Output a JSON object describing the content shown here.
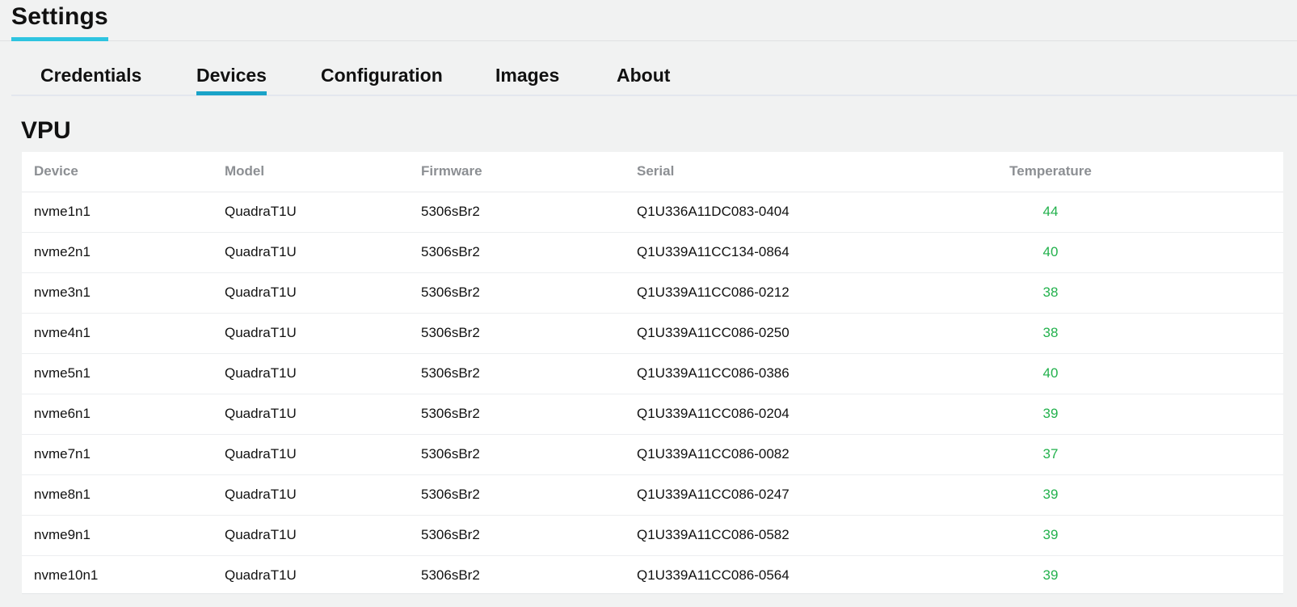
{
  "header": {
    "title": "Settings"
  },
  "tabs": [
    {
      "label": "Credentials",
      "active": false
    },
    {
      "label": "Devices",
      "active": true
    },
    {
      "label": "Configuration",
      "active": false
    },
    {
      "label": "Images",
      "active": false
    },
    {
      "label": "About",
      "active": false
    }
  ],
  "section": {
    "title": "VPU"
  },
  "colors": {
    "title_underline": "#2ec4e0",
    "active_tab_underline": "#1aa3c8",
    "temperature_ok": "#22b14c",
    "header_text": "#8c8f93"
  },
  "table": {
    "columns": [
      "Device",
      "Model",
      "Firmware",
      "Serial",
      "Temperature"
    ],
    "rows": [
      [
        "nvme1n1",
        "QuadraT1U",
        "5306sBr2",
        "Q1U336A11DC083-0404",
        "44"
      ],
      [
        "nvme2n1",
        "QuadraT1U",
        "5306sBr2",
        "Q1U339A11CC134-0864",
        "40"
      ],
      [
        "nvme3n1",
        "QuadraT1U",
        "5306sBr2",
        "Q1U339A11CC086-0212",
        "38"
      ],
      [
        "nvme4n1",
        "QuadraT1U",
        "5306sBr2",
        "Q1U339A11CC086-0250",
        "38"
      ],
      [
        "nvme5n1",
        "QuadraT1U",
        "5306sBr2",
        "Q1U339A11CC086-0386",
        "40"
      ],
      [
        "nvme6n1",
        "QuadraT1U",
        "5306sBr2",
        "Q1U339A11CC086-0204",
        "39"
      ],
      [
        "nvme7n1",
        "QuadraT1U",
        "5306sBr2",
        "Q1U339A11CC086-0082",
        "37"
      ],
      [
        "nvme8n1",
        "QuadraT1U",
        "5306sBr2",
        "Q1U339A11CC086-0247",
        "39"
      ],
      [
        "nvme9n1",
        "QuadraT1U",
        "5306sBr2",
        "Q1U339A11CC086-0582",
        "39"
      ],
      [
        "nvme10n1",
        "QuadraT1U",
        "5306sBr2",
        "Q1U339A11CC086-0564",
        "39"
      ]
    ]
  }
}
